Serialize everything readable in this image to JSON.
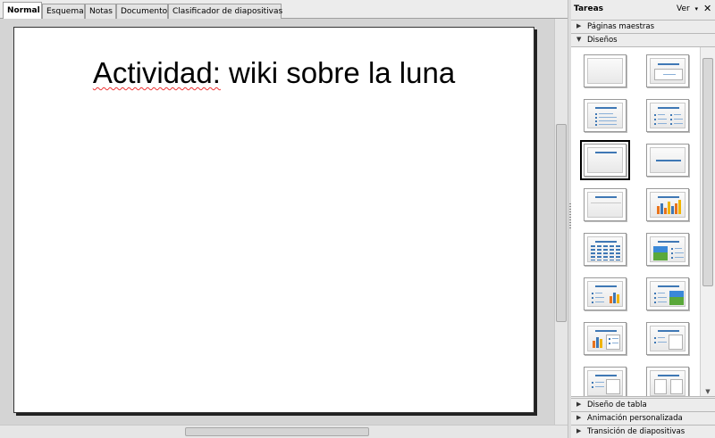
{
  "tabs": [
    {
      "label": "Normal",
      "active": true
    },
    {
      "label": "Esquema",
      "active": false
    },
    {
      "label": "Notas",
      "active": false
    },
    {
      "label": "Documento",
      "active": false
    },
    {
      "label": "Clasificador de diapositivas",
      "active": false
    }
  ],
  "slide": {
    "title_prefix": "Actividad:",
    "title_rest": " wiki sobre la luna"
  },
  "taskpane": {
    "title": "Tareas",
    "view_menu": "Ver",
    "view_arrow": "▾",
    "close_glyph": "✕",
    "sections": {
      "master_pages": "Páginas maestras",
      "layouts": "Diseños",
      "table_design": "Diseño de tabla",
      "custom_animation": "Animación personalizada",
      "slide_transition": "Transición de diapositivas"
    },
    "layouts": [
      {
        "id": "blank",
        "selected": false
      },
      {
        "id": "title-slide",
        "selected": false
      },
      {
        "id": "title-content",
        "selected": false
      },
      {
        "id": "title-two-content",
        "selected": false
      },
      {
        "id": "title-only",
        "selected": true
      },
      {
        "id": "centered-text",
        "selected": false
      },
      {
        "id": "title-two-content-wide",
        "selected": false
      },
      {
        "id": "title-chart",
        "selected": false
      },
      {
        "id": "title-table",
        "selected": false
      },
      {
        "id": "title-picture-content",
        "selected": false
      },
      {
        "id": "title-content-chart",
        "selected": false
      },
      {
        "id": "title-content-picture",
        "selected": false
      },
      {
        "id": "title-chart-content",
        "selected": false
      },
      {
        "id": "title-content-blank",
        "selected": false
      },
      {
        "id": "title-two-rows",
        "selected": false
      },
      {
        "id": "title-four-content",
        "selected": false
      }
    ]
  },
  "icons": {
    "collapsed": "▶",
    "expanded": "▼",
    "arrow_up": "▲",
    "arrow_down": "▼",
    "arrow_left": "◀",
    "arrow_right": "▶"
  },
  "colors": {
    "accent": "#3f78b5",
    "spellcheck": "#ee3333"
  }
}
